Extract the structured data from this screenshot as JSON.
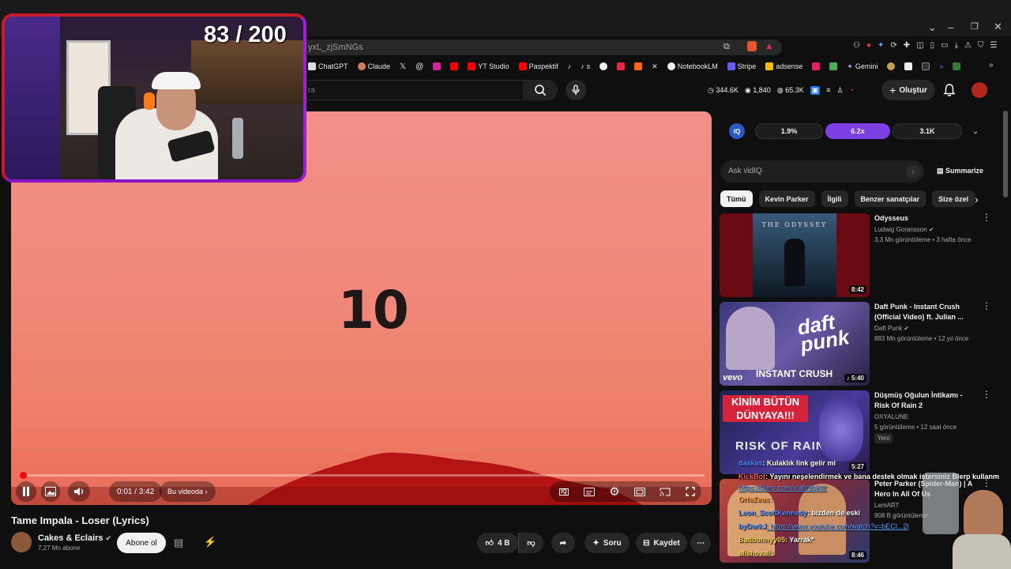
{
  "browser": {
    "url": "yxL_zjSmNGs",
    "bookmarks": [
      "ChatGPT",
      "Claude",
      "",
      "",
      "",
      "YT Studio",
      "Paspektif",
      "s",
      "",
      "",
      "",
      "",
      "NotebookLM",
      "Stripe",
      "adsense",
      "",
      "",
      "Gemini",
      "",
      "",
      "",
      "",
      ""
    ]
  },
  "header": {
    "search_hint": "ra",
    "stats": [
      "344.6K",
      "1,840",
      "65.3K"
    ],
    "create_label": "Oluştur"
  },
  "player": {
    "big_number": "10",
    "time": "0:01 / 3:42",
    "chapter": "Bu videoda",
    "progress_fraction": 0.003
  },
  "video": {
    "title": "Tame Impala - Loser (Lyrics)",
    "channel": "Cakes & Eclairs",
    "subscribers": "7,27 Mn abone",
    "subscribe_label": "Abone ol",
    "like_count": "4 B",
    "ask_label": "Soru",
    "save_label": "Kaydet"
  },
  "iq": {
    "logo": "IQ",
    "pill1": "1.9%",
    "pill2": "6.2x",
    "pill3": "3.1K",
    "ask_placeholder": "Ask vidIQ",
    "summarize": "Summarize"
  },
  "chips": [
    "Tümü",
    "Kevin Parker",
    "İlgili",
    "Benzer sanatçılar",
    "Size özel"
  ],
  "recommendations": [
    {
      "title": "Odysseus",
      "channel": "Ludwig Goransson",
      "meta": "3,3 Mn görüntüleme • 3 hafta önce",
      "duration": "8:42",
      "thumb_text": "THE ODYSSEY"
    },
    {
      "title": "Daft Punk - Instant Crush (Official Video) ft. Julian ...",
      "channel": "Daft Punk",
      "meta": "883 Mn görüntüleme • 12 yıl önce",
      "duration": "5:40",
      "thumb_text": "INSTANT CRUSH",
      "thumb_logo": "daft punk",
      "thumb_brand": "vevo"
    },
    {
      "title": "Düşmüş Oğulun İntikamı - Risk Of Rain 2",
      "channel": "OXYALUNE",
      "meta": "5 görüntüleme • 12 saat önce",
      "badge": "Yeni",
      "duration": "5:27",
      "thumb_text": "KİNİM BÜTÜN DÜNYAYA!!!",
      "thumb_sub": "RISK OF RAIN"
    },
    {
      "title": "Peter Parker (Spider-Man) | A Hero In All Of Us",
      "channel": "LemART",
      "meta": "908 B görüntüleme",
      "duration": "8:46"
    }
  ],
  "overlay": {
    "counter": "83 / 200"
  },
  "chat": [
    {
      "user": "daskas",
      "msg": ": Kulaklık link gelir mi"
    },
    {
      "user": "KickBot",
      "msg": ": Yayını neşelendirmek ve bana destek olmak istersiniz Blerp kullanm"
    },
    {
      "user": "",
      "msg": "https://blerp.com/x/allrdsiktir"
    },
    {
      "user": "OrfeZeus",
      "msg": ":"
    },
    {
      "user": "Leon_ScottKennedy",
      "msg": ": bizden de eski"
    },
    {
      "user": "byDarkJ",
      "msg": ": https://www.youtube.com/watch?v=bECl...2l"
    },
    {
      "user": "Badbunnyy05",
      "msg": ": Yarrak*"
    },
    {
      "user": "alishovali",
      "msg": ":"
    }
  ]
}
